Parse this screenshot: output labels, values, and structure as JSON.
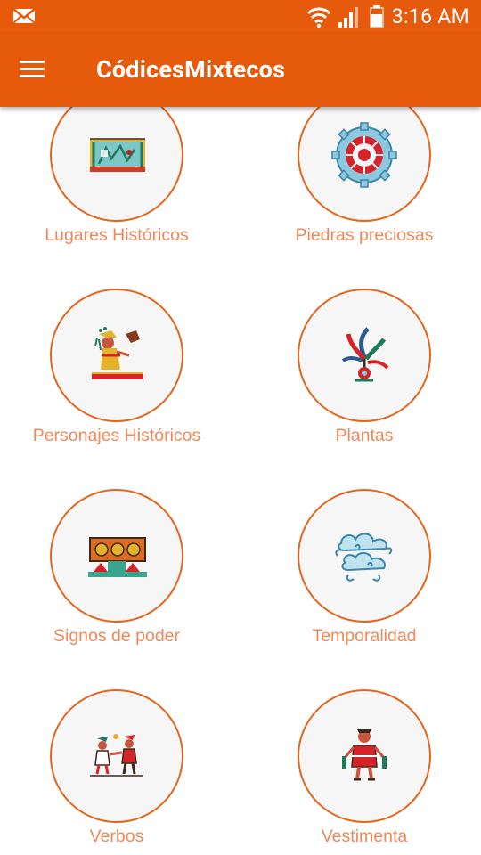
{
  "status_bar": {
    "time": "3:16 AM",
    "icons": [
      "email-icon",
      "wifi-icon",
      "signal-icon",
      "battery-icon"
    ]
  },
  "app_bar": {
    "title": "CódicesMixtecos",
    "menu_icon": "hamburger-menu-icon"
  },
  "categories": [
    {
      "label": "Lugares Históricos",
      "icon": "codex-place-glyph-icon"
    },
    {
      "label": "Piedras preciosas",
      "icon": "gemstone-wheel-icon"
    },
    {
      "label": "Personajes Históricos",
      "icon": "seated-figure-icon"
    },
    {
      "label": "Plantas",
      "icon": "plant-feather-icon"
    },
    {
      "label": "Signos de poder",
      "icon": "throne-glyph-icon"
    },
    {
      "label": "Temporalidad",
      "icon": "cloud-scroll-icon"
    },
    {
      "label": "Verbos",
      "icon": "figures-scene-icon"
    },
    {
      "label": "Vestimenta",
      "icon": "standing-figure-icon"
    }
  ],
  "colors": {
    "primary": "#e65a0b",
    "label": "#f0895a",
    "circle_border": "#e3661c",
    "circle_fill": "#f6f6f6"
  }
}
